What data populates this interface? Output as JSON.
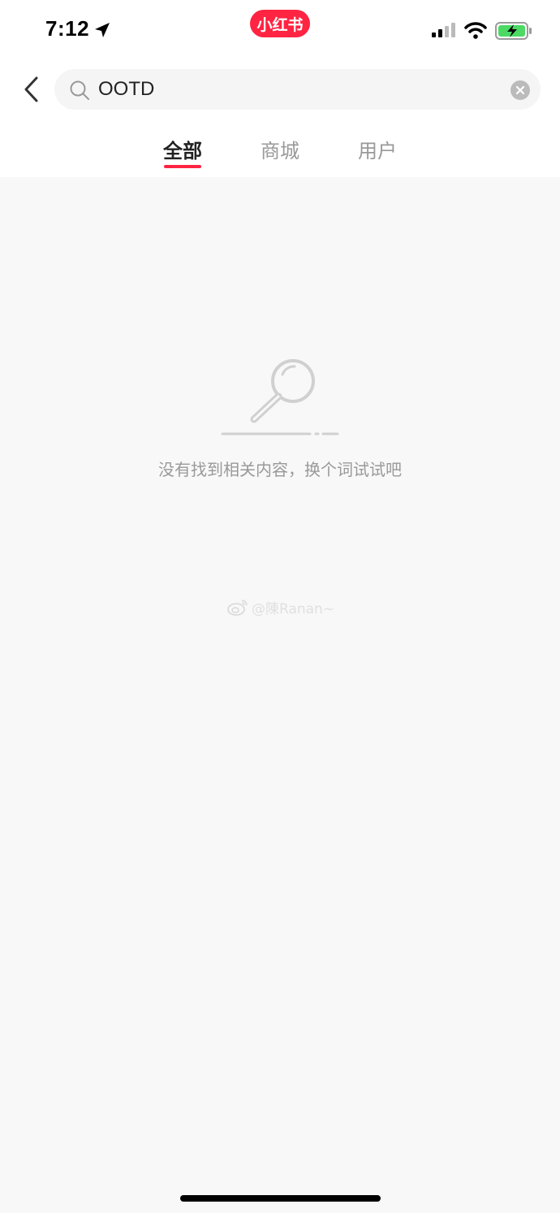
{
  "status_bar": {
    "time": "7:12",
    "location_icon": "location-arrow-icon",
    "app_badge": "小红书",
    "signal_icon": "cellular-signal-icon",
    "wifi_icon": "wifi-icon",
    "battery_icon": "battery-charging-icon"
  },
  "search": {
    "back_icon": "chevron-left-icon",
    "search_icon": "search-icon",
    "query": "OOTD",
    "clear_icon": "clear-circle-icon"
  },
  "tabs": [
    {
      "label": "全部",
      "active": true
    },
    {
      "label": "商城",
      "active": false
    },
    {
      "label": "用户",
      "active": false
    }
  ],
  "empty_state": {
    "icon": "magnifier-icon",
    "message": "没有找到相关内容，换个词试试吧"
  },
  "watermark": {
    "icon": "weibo-icon",
    "text": "@陳Ranan~"
  },
  "colors": {
    "accent": "#ff2442",
    "background": "#f8f8f8",
    "header_background": "#ffffff",
    "muted_text": "#999999",
    "active_text": "#222222"
  }
}
